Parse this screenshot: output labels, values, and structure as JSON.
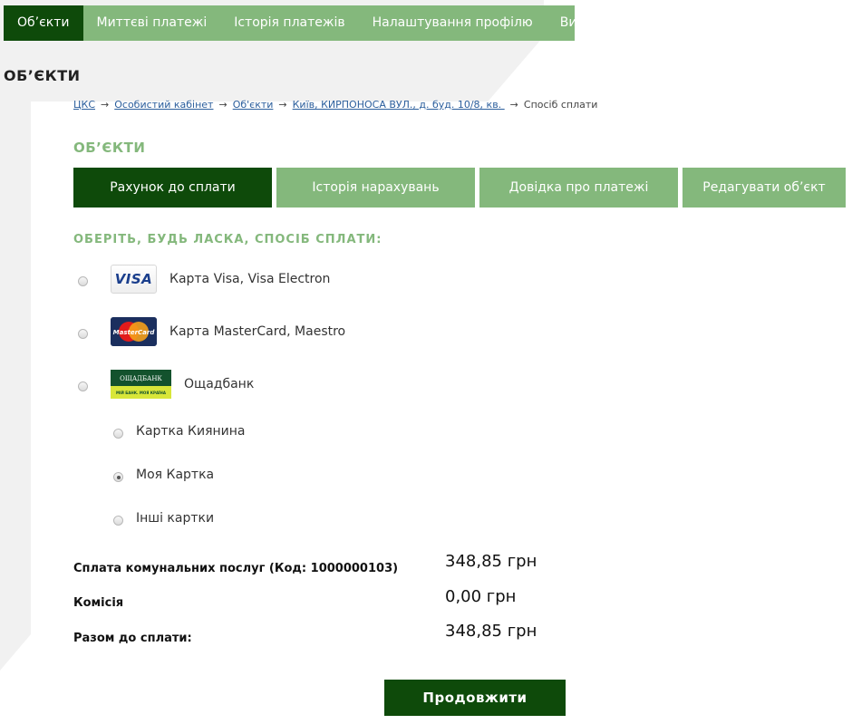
{
  "nav": {
    "items": [
      {
        "label": "Об’єкти",
        "active": true
      },
      {
        "label": "Миттєві платежі",
        "active": false
      },
      {
        "label": "Історія платежів",
        "active": false
      },
      {
        "label": "Налаштування профілю",
        "active": false
      },
      {
        "label": "Вихід",
        "active": false
      }
    ]
  },
  "page_heading": "ОБ’ЄКТИ",
  "breadcrumb": {
    "items": [
      "ЦКС",
      "Особистий кабінет",
      "Об'єкти",
      "Київ, КИРПОНОСА ВУЛ., д. буд. 10/8, кв. ",
      "Спосіб сплати"
    ],
    "separator": "→"
  },
  "section_title": "ОБ’ЄКТИ",
  "tabs": [
    {
      "label": "Рахунок до сплати",
      "active": true
    },
    {
      "label": "Історія нарахувань",
      "active": false
    },
    {
      "label": "Довідка про платежі",
      "active": false
    },
    {
      "label": "Редагувати об’єкт",
      "active": false
    }
  ],
  "choose_title": "ОБЕРІТЬ, БУДЬ ЛАСКА, СПОСІБ СПЛАТИ:",
  "payment_methods": [
    {
      "label": "Карта Visa, Visa Electron",
      "logo": "visa-logo",
      "logo_text": "VISA",
      "selected": false
    },
    {
      "label": "Карта MasterCard, Maestro",
      "logo": "mastercard-logo",
      "logo_text": "MasterCard",
      "selected": false
    },
    {
      "label": "Ощадбанк",
      "logo": "oschadbank-logo",
      "logo_text": "ОЩАДБАНК",
      "logo_slogan": "МІЙ БАНК. МОЯ КРАЇНА",
      "selected": false
    }
  ],
  "oschad_options": [
    {
      "label": "Картка Киянина",
      "selected": false
    },
    {
      "label": "Моя Картка",
      "selected": true
    },
    {
      "label": "Інші картки",
      "selected": false
    }
  ],
  "summary": {
    "service_label": "Сплата комунальних послуг (Код: 1000000103)",
    "service_value": "348,85 грн",
    "fee_label": "Комісія",
    "fee_value": "0,00 грн",
    "total_label": "Разом до сплати:",
    "total_value": "348,85 грн"
  },
  "continue_label": "Продовжити",
  "colors": {
    "dark_green": "#0e4a0a",
    "light_green": "#84b87c"
  }
}
